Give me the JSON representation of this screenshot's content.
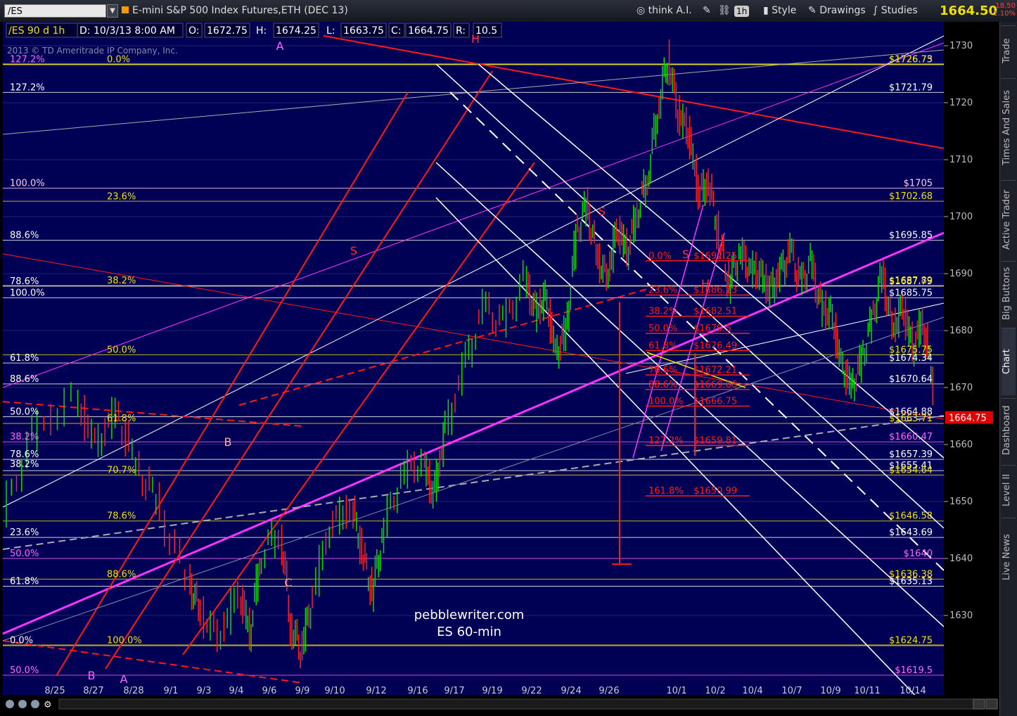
{
  "toolbar": {
    "symbol": "/ES",
    "title": "E-mini S&P 500 Index Futures,ETH (DEC 13)",
    "think_ai": "think A.I.",
    "timeframe": "1h",
    "style": "Style",
    "drawings": "Drawings",
    "studies": "Studies",
    "last_price": "1664.50",
    "change": "-18.50",
    "change_pct": "-1.10%"
  },
  "sidebar": {
    "tabs": [
      "Trade",
      "Times And Sales",
      "Active Trader",
      "Big Buttons",
      "Chart",
      "Dashboard",
      "Level II",
      "Live News"
    ]
  },
  "infobar": {
    "symbol": "/ES 90 d 1h",
    "date": "D: 10/3/13 8:00 AM",
    "open": "O:",
    "open_val": "1672.75",
    "high": "H:",
    "high_val": "1674.25",
    "low_val": "1663.75",
    "close": "C:",
    "close_val": "1664.75",
    "range": "R:",
    "range_val": "10.5"
  },
  "copyright": "2013 © TD Ameritrade IP Company, Inc.",
  "watermark": [
    "pebblewriter.com",
    "ES 60-min"
  ],
  "colors": {
    "background": "#000055",
    "up": "#00dd00",
    "down": "#ff2020",
    "yellow": "#f0e000",
    "red": "#ff1a1a",
    "magenta": "#ff33ff",
    "white": "#ffffff"
  },
  "chart_data": {
    "type": "line",
    "x_ticks": [
      "8/25",
      "8/27",
      "8/28",
      "9/1",
      "9/3",
      "9/4",
      "9/6",
      "9/9",
      "9/10",
      "9/12",
      "9/16",
      "9/17",
      "9/19",
      "9/22",
      "9/24",
      "9/26",
      "10/1",
      "10/2",
      "10/4",
      "10/7",
      "10/9",
      "10/11",
      "10/14"
    ],
    "y_ticks": [
      1630,
      1640,
      1650,
      1660,
      1670,
      1680,
      1690,
      1700,
      1710,
      1720,
      1730
    ],
    "ylim": [
      1617,
      1732
    ],
    "current_price": "1664.75",
    "price_path": [
      [
        0,
        1648
      ],
      [
        3,
        1662
      ],
      [
        7,
        1668
      ],
      [
        9,
        1660
      ],
      [
        11,
        1666
      ],
      [
        13,
        1656
      ],
      [
        15,
        1650
      ],
      [
        18,
        1636
      ],
      [
        19,
        1631
      ],
      [
        21,
        1626
      ],
      [
        23,
        1634
      ],
      [
        24,
        1627
      ],
      [
        25,
        1640
      ],
      [
        27,
        1645
      ],
      [
        28,
        1628
      ],
      [
        29,
        1624
      ],
      [
        30,
        1632
      ],
      [
        32,
        1646
      ],
      [
        34,
        1649
      ],
      [
        35,
        1641
      ],
      [
        36,
        1634
      ],
      [
        37,
        1644
      ],
      [
        39,
        1655
      ],
      [
        41,
        1657
      ],
      [
        42,
        1651
      ],
      [
        43,
        1661
      ],
      [
        45,
        1673
      ],
      [
        47,
        1684
      ],
      [
        49,
        1681
      ],
      [
        51,
        1689
      ],
      [
        52,
        1683
      ],
      [
        53,
        1686
      ],
      [
        54,
        1676
      ],
      [
        55,
        1680
      ],
      [
        56,
        1697
      ],
      [
        57,
        1702
      ],
      [
        58,
        1693
      ],
      [
        59,
        1689
      ],
      [
        60,
        1698
      ],
      [
        61,
        1694
      ],
      [
        62,
        1701
      ],
      [
        63,
        1707
      ],
      [
        64,
        1719
      ],
      [
        65,
        1728
      ],
      [
        66,
        1718
      ],
      [
        67,
        1715
      ],
      [
        68,
        1704
      ],
      [
        69,
        1706
      ],
      [
        70,
        1696
      ],
      [
        71,
        1688
      ],
      [
        72,
        1694
      ],
      [
        73,
        1691
      ],
      [
        74,
        1690
      ],
      [
        75,
        1687
      ],
      [
        76,
        1690
      ],
      [
        77,
        1694
      ],
      [
        78,
        1688
      ],
      [
        79,
        1692
      ],
      [
        80,
        1684
      ],
      [
        81,
        1683
      ],
      [
        82,
        1674
      ],
      [
        83,
        1670
      ],
      [
        84,
        1675
      ],
      [
        85,
        1682
      ],
      [
        86,
        1690
      ],
      [
        87,
        1680
      ],
      [
        88,
        1684
      ],
      [
        89,
        1677
      ],
      [
        90,
        1682
      ],
      [
        91,
        1670
      ]
    ],
    "right_labels": [
      {
        "text": "$1726.73",
        "price": 1726.7,
        "color": "#ffffff"
      },
      {
        "text": "$1726.75",
        "price": 1726.75,
        "color": "#f0e000"
      },
      {
        "text": "$1721.79",
        "price": 1721.8,
        "color": "#ffffff"
      },
      {
        "text": "$1705",
        "price": 1705,
        "color": "#ffccee"
      },
      {
        "text": "$1702.68",
        "price": 1702.7,
        "color": "#f0e000"
      },
      {
        "text": "$1695.85",
        "price": 1695.85,
        "color": "#ffffff"
      },
      {
        "text": "$1687.79",
        "price": 1687.8,
        "color": "#ffffff"
      },
      {
        "text": "$1687.89",
        "price": 1687.9,
        "color": "#f0e000"
      },
      {
        "text": "$1685.75",
        "price": 1685.75,
        "color": "#ffffff"
      },
      {
        "text": "$1675.75",
        "price": 1675.75,
        "color": "#f0e000"
      },
      {
        "text": "$1674.34",
        "price": 1674.3,
        "color": "#ffffff"
      },
      {
        "text": "$1670.64",
        "price": 1670.64,
        "color": "#ffffff"
      },
      {
        "text": "$1664.88",
        "price": 1664.88,
        "color": "#ffffff"
      },
      {
        "text": "$1663.71",
        "price": 1663.71,
        "color": "#f0e000"
      },
      {
        "text": "$1660.47",
        "price": 1660.47,
        "color": "#ff66ff"
      },
      {
        "text": "$1657.39",
        "price": 1657.39,
        "color": "#ffffff"
      },
      {
        "text": "$1655.41",
        "price": 1655.41,
        "color": "#ffffff"
      },
      {
        "text": "$1654.64",
        "price": 1654.64,
        "color": "#f0e000"
      },
      {
        "text": "$1646.58",
        "price": 1646.58,
        "color": "#f0e000"
      },
      {
        "text": "$1643.69",
        "price": 1643.69,
        "color": "#ffffff"
      },
      {
        "text": "$1640",
        "price": 1640,
        "color": "#ff66ff"
      },
      {
        "text": "$1636.38",
        "price": 1636.38,
        "color": "#f0e000"
      },
      {
        "text": "$1635.13",
        "price": 1635.13,
        "color": "#ffffff"
      },
      {
        "text": "$1624.75",
        "price": 1624.75,
        "color": "#f0e000"
      },
      {
        "text": "$1619.5",
        "price": 1619.5,
        "color": "#ff66ff"
      }
    ],
    "left_labels": [
      {
        "text": "127.2%",
        "price": 1726.7,
        "color": "#ff66ff",
        "x": 14
      },
      {
        "text": "127.2%",
        "price": 1721.8,
        "color": "#ffffff",
        "x": 14
      },
      {
        "text": "100.0%",
        "price": 1705,
        "color": "#ffccee",
        "x": 14
      },
      {
        "text": "88.6%",
        "price": 1695.85,
        "color": "#ffffff",
        "x": 14
      },
      {
        "text": "78.6%",
        "price": 1687.8,
        "color": "#ffffff",
        "x": 14
      },
      {
        "text": "100.0%",
        "price": 1685.75,
        "color": "#ffffff",
        "x": 14
      },
      {
        "text": "61.8%",
        "price": 1674.3,
        "color": "#ffffff",
        "x": 14
      },
      {
        "text": "88.6%",
        "price": 1670.64,
        "color": "#ffffff",
        "x": 14
      },
      {
        "text": "50.0%",
        "price": 1664.88,
        "color": "#ffffff",
        "x": 14
      },
      {
        "text": "38.2%",
        "price": 1660.47,
        "color": "#ff66ff",
        "x": 14
      },
      {
        "text": "78.6%",
        "price": 1657.39,
        "color": "#ffffff",
        "x": 14
      },
      {
        "text": "38.2%",
        "price": 1655.7,
        "color": "#ffffff",
        "x": 14
      },
      {
        "text": "23.6%",
        "price": 1643.69,
        "color": "#ffffff",
        "x": 14
      },
      {
        "text": "50.0%",
        "price": 1640,
        "color": "#ff66ff",
        "x": 14
      },
      {
        "text": "61.8%",
        "price": 1635.13,
        "color": "#ffffff",
        "x": 14
      },
      {
        "text": "0.0%",
        "price": 1624.75,
        "color": "#ffffff",
        "x": 14
      },
      {
        "text": "50.0%",
        "price": 1619.5,
        "color": "#ff66ff",
        "x": 14
      },
      {
        "text": "0.0%",
        "price": 1726.75,
        "color": "#f0e000",
        "x": 152
      },
      {
        "text": "23.6%",
        "price": 1702.68,
        "color": "#f0e000",
        "x": 152
      },
      {
        "text": "38.2%",
        "price": 1687.89,
        "color": "#f0e000",
        "x": 152
      },
      {
        "text": "50.0%",
        "price": 1675.75,
        "color": "#f0e000",
        "x": 152
      },
      {
        "text": "61.8%",
        "price": 1663.71,
        "color": "#f0e000",
        "x": 152
      },
      {
        "text": "70.7%",
        "price": 1654.64,
        "color": "#f0e000",
        "x": 152
      },
      {
        "text": "78.6%",
        "price": 1646.58,
        "color": "#f0e000",
        "x": 152
      },
      {
        "text": "88.6%",
        "price": 1636.38,
        "color": "#f0e000",
        "x": 152
      },
      {
        "text": "100.0%",
        "price": 1624.75,
        "color": "#f0e000",
        "x": 152
      }
    ],
    "fib_small": [
      {
        "text": "0.0%",
        "price": 1692.25
      },
      {
        "text": "$1692.25",
        "price": 1692.25
      },
      {
        "text": "23.6%",
        "price": 1686.23
      },
      {
        "text": "$1686.23",
        "price": 1686.23
      },
      {
        "text": "38.2%",
        "price": 1682.51
      },
      {
        "text": "$1682.51",
        "price": 1682.51
      },
      {
        "text": "50.0%",
        "price": 1679.5
      },
      {
        "text": "$1679.5",
        "price": 1679.5
      },
      {
        "text": "61.8%",
        "price": 1676.49
      },
      {
        "text": "$1676.49",
        "price": 1676.49
      },
      {
        "text": "78.6%",
        "price": 1672.21
      },
      {
        "text": "$1672.21",
        "price": 1672.21
      },
      {
        "text": "88.6%",
        "price": 1669.66
      },
      {
        "text": "$1669.66",
        "price": 1669.66
      },
      {
        "text": "100.0%",
        "price": 1666.75
      },
      {
        "text": "$1666.75",
        "price": 1666.75
      },
      {
        "text": "127.2%",
        "price": 1659.81
      },
      {
        "text": "$1659.81",
        "price": 1659.81
      },
      {
        "text": "161.8%",
        "price": 1650.99
      },
      {
        "text": "$1650.99",
        "price": 1650.99
      }
    ],
    "wave_labels": [
      {
        "text": "A",
        "color": "#ff66ff"
      },
      {
        "text": "B",
        "color": "#ff66ff"
      },
      {
        "text": "A",
        "color": "#ff66ff"
      },
      {
        "text": "B",
        "color": "#ffaaaa"
      },
      {
        "text": "C",
        "color": "#ffaaaa"
      },
      {
        "text": "S",
        "color": "#ff3030"
      },
      {
        "text": "S",
        "color": "#ff3030"
      },
      {
        "text": "H",
        "color": "#ff3030"
      },
      {
        "text": "S",
        "color": "#ff3030"
      },
      {
        "text": "H",
        "color": "#ff3030"
      }
    ]
  }
}
